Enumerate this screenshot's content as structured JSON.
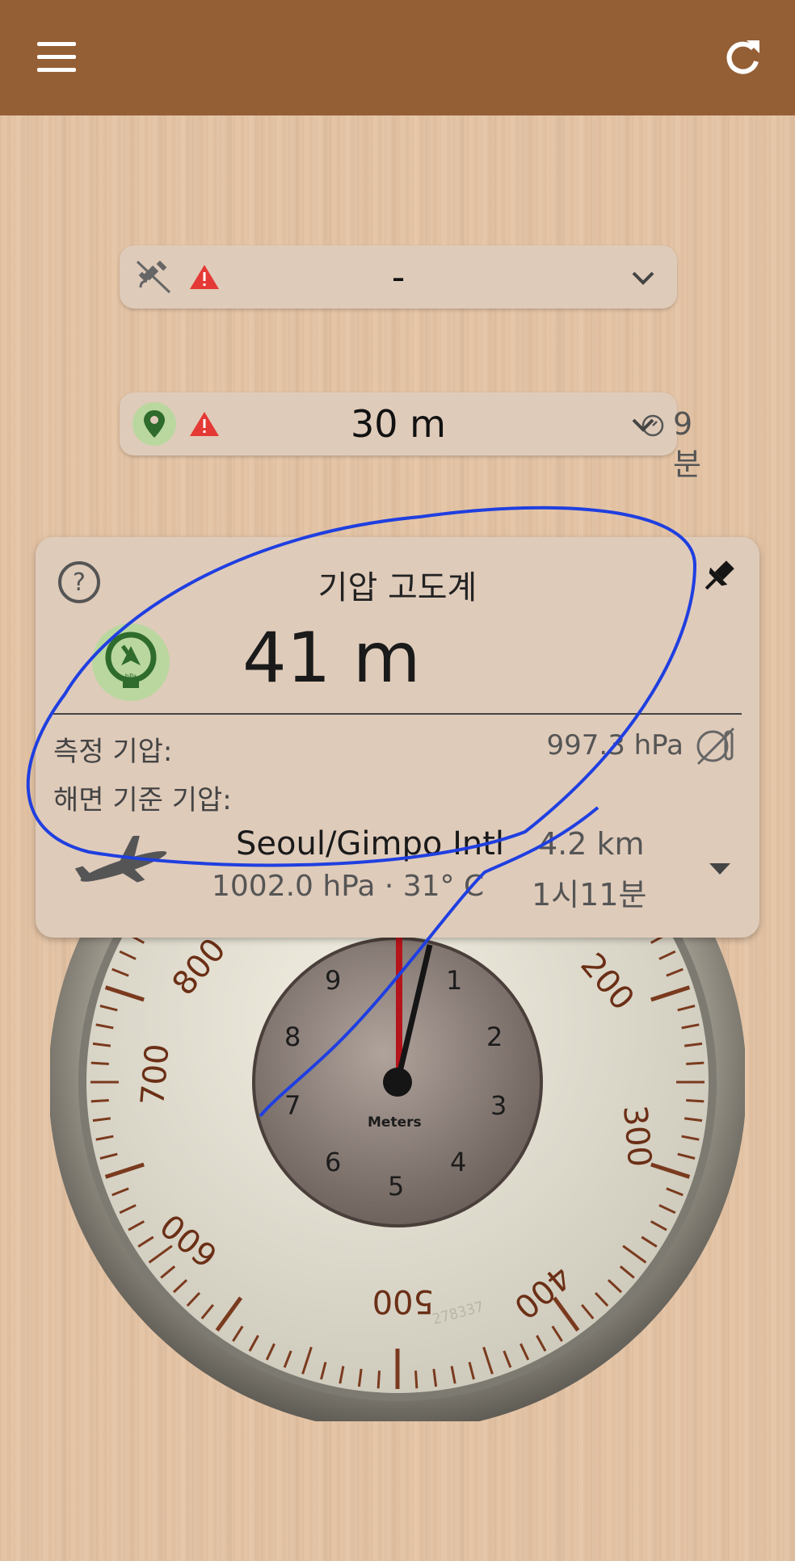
{
  "header": {
    "menu_icon": "hamburger-menu-icon",
    "refresh_icon": "refresh-icon",
    "background_color": "#955f36"
  },
  "gps_pill": {
    "icon": "satellite-off-icon",
    "warning_icon": "warning-triangle-icon",
    "value": "-",
    "expand_icon": "chevron-down-icon"
  },
  "location_pill": {
    "icon": "location-pin-icon",
    "warning_icon": "warning-triangle-icon",
    "value": "30 m",
    "age": "9분",
    "timer_icon": "timer-icon",
    "expand_icon": "chevron-down-icon"
  },
  "altimeter_card": {
    "help_icon": "help-icon",
    "pin_icon": "pin-icon",
    "title": "기압 고도계",
    "altitude": "41 m",
    "altimeter_icon": "barometer-hpa-icon",
    "altimeter_icon_label": "hPa",
    "measured_pressure_label": "측정 기압:",
    "measured_pressure_value": "997.3 hPa",
    "sensor_icon": "sensor-off-icon",
    "sea_level_pressure_label": "해면 기준 기압:",
    "station": {
      "icon": "airplane-icon",
      "name": "Seoul/Gimpo Intl",
      "detail": "1002.0 hPa · 31° C",
      "distance": "4.2 km",
      "age": "1시11분",
      "dropdown_icon": "triangle-down-icon"
    }
  },
  "gauge": {
    "outer_labels": [
      "800",
      "200",
      "700",
      "300",
      "600",
      "400",
      "500"
    ],
    "inner_labels": [
      "9",
      "1",
      "8",
      "2",
      "7",
      "3",
      "6",
      "4",
      "5"
    ],
    "inner_caption": "Meters",
    "serial": "278337"
  },
  "colors": {
    "accent_green": "#3d8a3a",
    "warning_red": "#e53935",
    "annotation_blue": "#1f3fe0"
  }
}
